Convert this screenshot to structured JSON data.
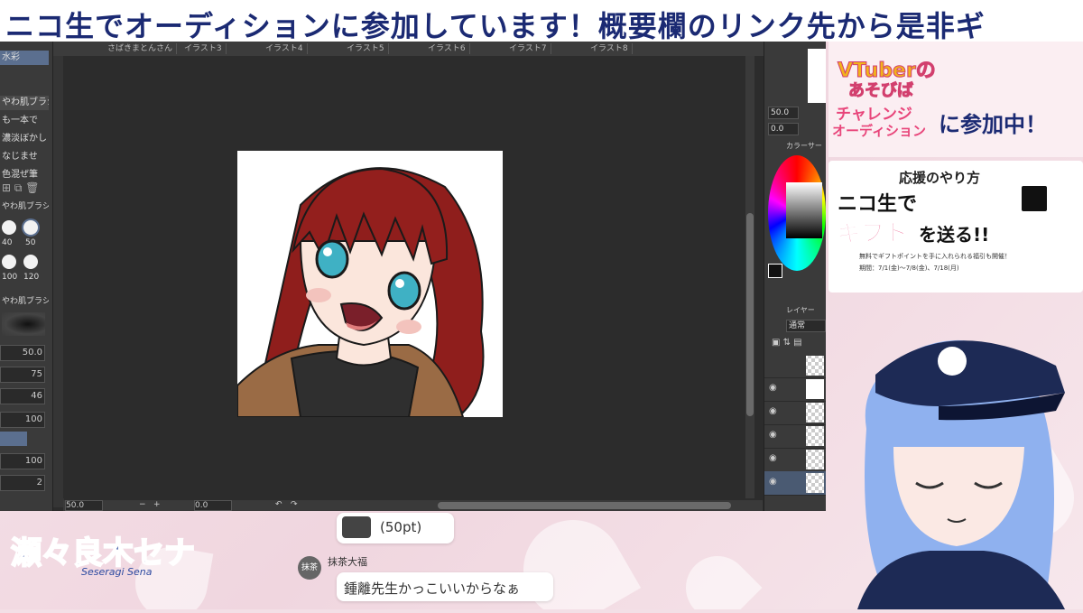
{
  "banner": {
    "text": "ニコ生でオーディションに参加しています！概要欄のリンク先から是非ギ"
  },
  "app": {
    "tabs": [
      "さばきまとんさん",
      "イラスト3",
      "イラスト4",
      "イラスト5",
      "イラスト6",
      "イラスト7",
      "イラスト8"
    ],
    "left": {
      "brush_tab": "水彩",
      "brush_items": [
        "やわ肌ブラシ",
        "も一本で",
        "濃淡ぼかし",
        "なじませ",
        "色混ぜ筆"
      ],
      "sub_tab": "やわ肌ブラシ",
      "size_labels": [
        "40",
        "50",
        "100",
        "120"
      ],
      "sub_tab2": "やわ肌ブラシ",
      "values": [
        "50.0",
        "75",
        "46",
        "100",
        "100",
        "2"
      ]
    },
    "bottom": {
      "zoom": "50.0",
      "angle": "0.0"
    },
    "right": {
      "field1": "50.0",
      "field2": "0.0",
      "color_tab": "カラーサー",
      "layer_tab": "レイヤー",
      "blend_mode": "通常"
    }
  },
  "promo": {
    "line1": "VTuberの",
    "line2": "あそびば",
    "line3": "チャレンジ",
    "line4": "オーディション",
    "join": "に参加中！",
    "how_title": "応援のやり方",
    "big1": "ニコ生で",
    "big2": "ギフト",
    "big3": "を送る!!",
    "small": "無料でギフトポイントを手に入れられる福引も開催！",
    "period": "期間：7/1(金)〜7/8(金)、7/18(月)"
  },
  "logo": {
    "main": "瀬々良木セナ",
    "sub": "Seseragi Sena"
  },
  "chat": {
    "gift_points": "(50pt)",
    "user_avatar": "抹茶",
    "user_name": "抹茶大福",
    "message": "鍾離先生かっこいいからなぁ"
  },
  "colors": {
    "banner_text": "#1b2a73",
    "app_bg": "#2c2c2c",
    "promo_pink": "#e8457a"
  }
}
